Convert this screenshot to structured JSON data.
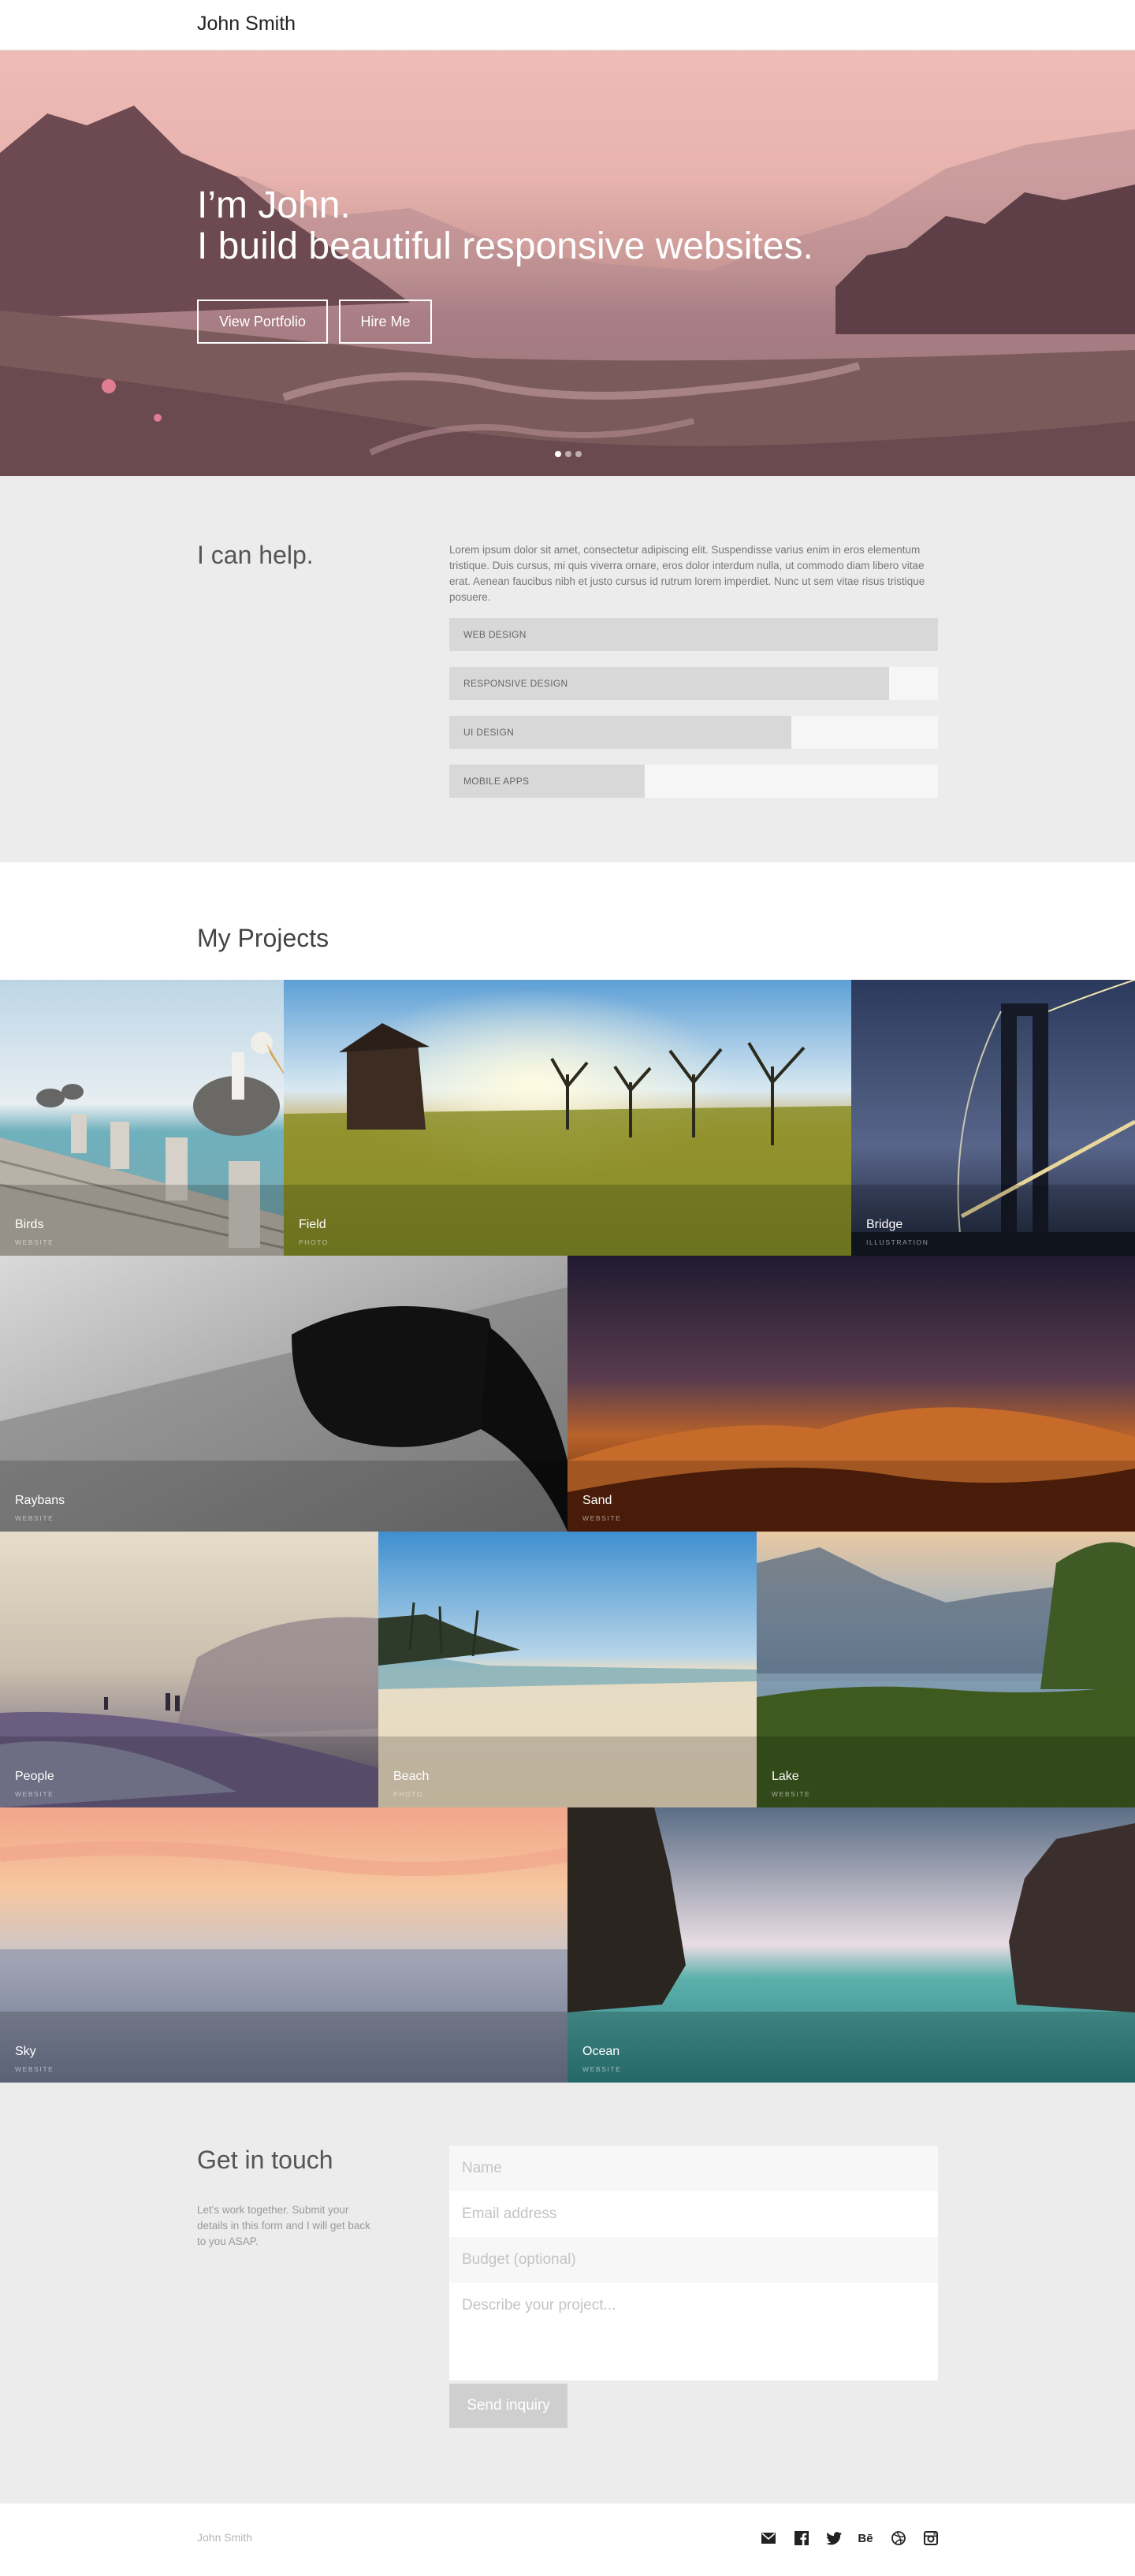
{
  "header": {
    "brand": "John Smith"
  },
  "hero": {
    "line1": "I’m John.",
    "line2": "I build beautiful responsive websites.",
    "buttons": {
      "portfolio": "View Portfolio",
      "hire": "Hire Me"
    },
    "slides": 3,
    "active_slide": 1
  },
  "help": {
    "title": "I can help.",
    "text": "Lorem ipsum dolor sit amet, consectetur adipiscing elit. Suspendisse varius enim in eros elementum tristique. Duis cursus, mi quis viverra ornare, eros dolor interdum nulla, ut commodo diam libero vitae erat. Aenean faucibus nibh et justo cursus id rutrum lorem imperdiet. Nunc ut sem vitae risus tristique posuere.",
    "skills": [
      {
        "label": "WEB DESIGN",
        "level": 1.0
      },
      {
        "label": "RESPONSIVE DESIGN",
        "level": 0.9
      },
      {
        "label": "UI DESIGN",
        "level": 0.7
      },
      {
        "label": "MOBILE APPS",
        "level": 0.4
      }
    ]
  },
  "projects": {
    "title": "My Projects",
    "items": [
      {
        "name": "Birds",
        "category": "WEBSITE"
      },
      {
        "name": "Field",
        "category": "PHOTO"
      },
      {
        "name": "Bridge",
        "category": "ILLUSTRATION"
      },
      {
        "name": "Raybans",
        "category": "WEBSITE"
      },
      {
        "name": "Sand",
        "category": "WEBSITE"
      },
      {
        "name": "People",
        "category": "WEBSITE"
      },
      {
        "name": "Beach",
        "category": "PHOTO"
      },
      {
        "name": "Lake",
        "category": "WEBSITE"
      },
      {
        "name": "Sky",
        "category": "WEBSITE"
      },
      {
        "name": "Ocean",
        "category": "WEBSITE"
      }
    ]
  },
  "contact": {
    "title": "Get in touch",
    "text": "Let's work together. Submit your details in this form and I will get back to you ASAP.",
    "placeholders": {
      "name": "Name",
      "email": "Email address",
      "budget": "Budget (optional)",
      "project": "Describe your project..."
    },
    "submit": "Send inquiry"
  },
  "footer": {
    "name": "John Smith",
    "social": [
      "mail-icon",
      "facebook-icon",
      "twitter-icon",
      "behance-icon",
      "dribbble-icon",
      "instagram-icon"
    ]
  }
}
